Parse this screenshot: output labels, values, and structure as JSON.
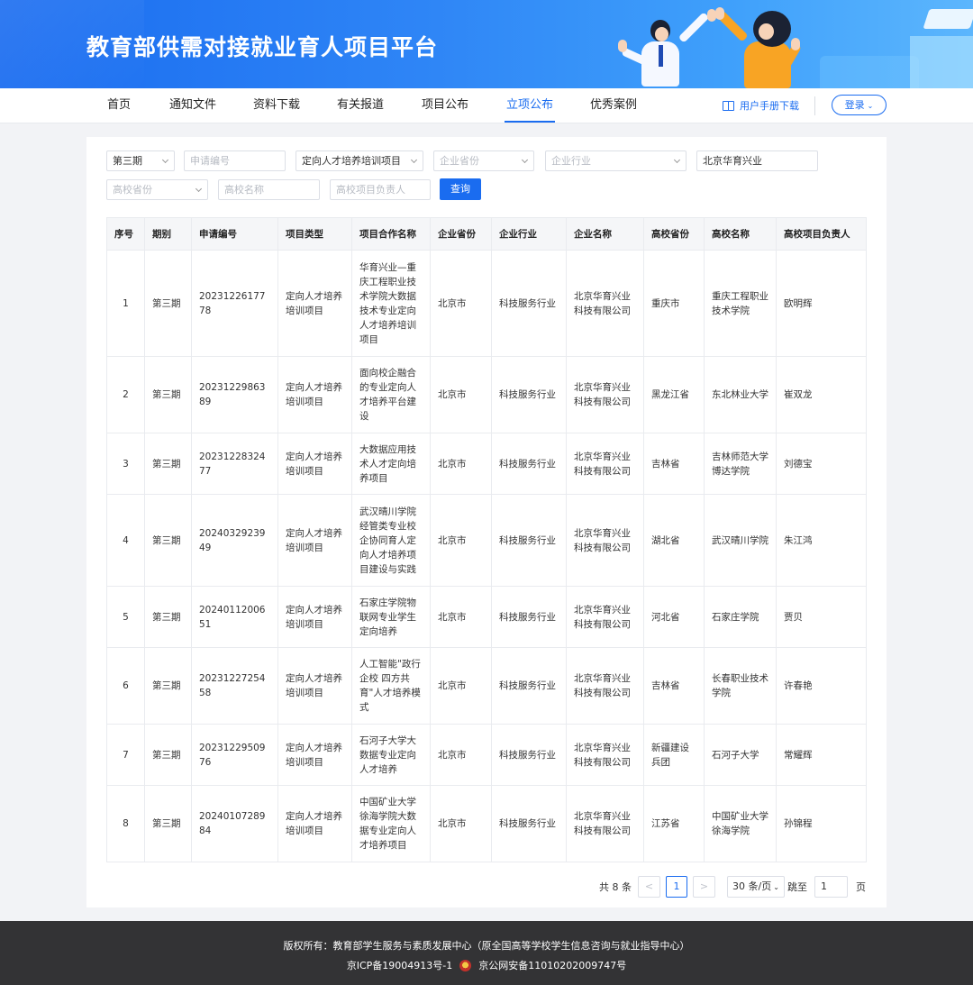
{
  "header": {
    "title": "教育部供需对接就业育人项目平台"
  },
  "nav": {
    "items": [
      "首页",
      "通知文件",
      "资料下载",
      "有关报道",
      "项目公布",
      "立项公布",
      "优秀案例"
    ],
    "active": "立项公布",
    "manual_label": "用户手册下载",
    "login_label": "登录"
  },
  "filters": {
    "period": "第三期",
    "app_no_placeholder": "申请编号",
    "project_type": "定向人才培养培训项目",
    "company_province_placeholder": "企业省份",
    "company_industry_placeholder": "企业行业",
    "company_name": "北京华育兴业",
    "school_province_placeholder": "高校省份",
    "school_name_placeholder": "高校名称",
    "school_lead_placeholder": "高校项目负责人",
    "search_label": "查询"
  },
  "table": {
    "headers": [
      "序号",
      "期别",
      "申请编号",
      "项目类型",
      "项目合作名称",
      "企业省份",
      "企业行业",
      "企业名称",
      "高校省份",
      "高校名称",
      "高校项目负责人"
    ],
    "rows": [
      [
        "1",
        "第三期",
        "2023122617778",
        "定向人才培养培训项目",
        "华育兴业—重庆工程职业技术学院大数据技术专业定向人才培养培训项目",
        "北京市",
        "科技服务行业",
        "北京华育兴业科技有限公司",
        "重庆市",
        "重庆工程职业技术学院",
        "欧明辉"
      ],
      [
        "2",
        "第三期",
        "2023122986389",
        "定向人才培养培训项目",
        "面向校企融合的专业定向人才培养平台建设",
        "北京市",
        "科技服务行业",
        "北京华育兴业科技有限公司",
        "黑龙江省",
        "东北林业大学",
        "崔双龙"
      ],
      [
        "3",
        "第三期",
        "2023122832477",
        "定向人才培养培训项目",
        "大数据应用技术人才定向培养项目",
        "北京市",
        "科技服务行业",
        "北京华育兴业科技有限公司",
        "吉林省",
        "吉林师范大学博达学院",
        "刘德宝"
      ],
      [
        "4",
        "第三期",
        "2024032923949",
        "定向人才培养培训项目",
        "武汉晴川学院经管类专业校企协同育人定向人才培养项目建设与实践",
        "北京市",
        "科技服务行业",
        "北京华育兴业科技有限公司",
        "湖北省",
        "武汉晴川学院",
        "朱江鸿"
      ],
      [
        "5",
        "第三期",
        "2024011200651",
        "定向人才培养培训项目",
        "石家庄学院物联网专业学生定向培养",
        "北京市",
        "科技服务行业",
        "北京华育兴业科技有限公司",
        "河北省",
        "石家庄学院",
        "贾贝"
      ],
      [
        "6",
        "第三期",
        "2023122725458",
        "定向人才培养培训项目",
        "人工智能\"政行企校 四方共育\"人才培养模式",
        "北京市",
        "科技服务行业",
        "北京华育兴业科技有限公司",
        "吉林省",
        "长春职业技术学院",
        "许春艳"
      ],
      [
        "7",
        "第三期",
        "2023122950976",
        "定向人才培养培训项目",
        "石河子大学大数据专业定向人才培养",
        "北京市",
        "科技服务行业",
        "北京华育兴业科技有限公司",
        "新疆建设兵团",
        "石河子大学",
        "常耀辉"
      ],
      [
        "8",
        "第三期",
        "2024010728984",
        "定向人才培养培训项目",
        "中国矿业大学徐海学院大数据专业定向人才培养项目",
        "北京市",
        "科技服务行业",
        "北京华育兴业科技有限公司",
        "江苏省",
        "中国矿业大学徐海学院",
        "孙锦程"
      ]
    ]
  },
  "pagination": {
    "total": "共 8 条",
    "prev": "<",
    "current": "1",
    "next": ">",
    "page_size": "30 条/页",
    "goto_label": "跳至",
    "goto_value": "1",
    "page_suffix": "页"
  },
  "footer": {
    "copyright": "版权所有：教育部学生服务与素质发展中心（原全国高等学校学生信息咨询与就业指导中心）",
    "icp": "京ICP备19004913号-1",
    "police": "京公网安备11010202009747号"
  }
}
